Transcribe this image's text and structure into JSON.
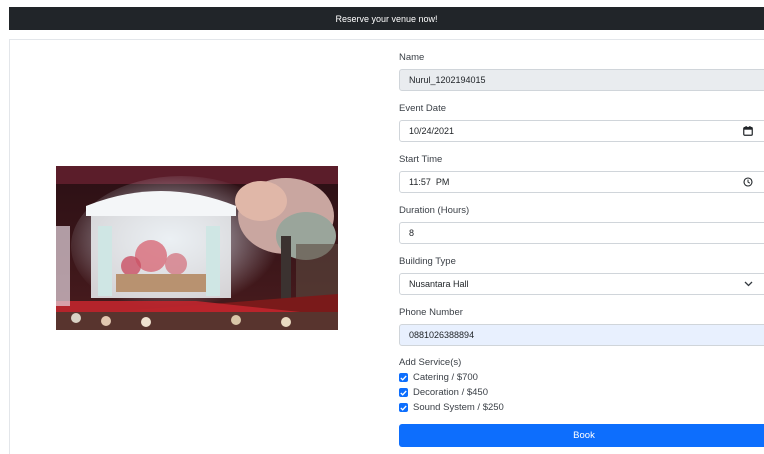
{
  "header": {
    "title": "Reserve your venue now!"
  },
  "form": {
    "name": {
      "label": "Name",
      "value": "Nurul_1202194015"
    },
    "event_date": {
      "label": "Event Date",
      "value": "10/24/2021",
      "icon": "calendar-icon"
    },
    "start_time": {
      "label": "Start Time",
      "value": "11:57  PM",
      "icon": "clock-icon"
    },
    "duration": {
      "label": "Duration (Hours)",
      "value": "8"
    },
    "building_type": {
      "label": "Building Type",
      "selected": "Nusantara Hall",
      "icon": "chevron-down-icon"
    },
    "phone": {
      "label": "Phone Number",
      "value": "0881026388894"
    },
    "services": {
      "label": "Add Service(s)",
      "items": [
        {
          "label": "Catering / $700",
          "checked": true
        },
        {
          "label": "Decoration / $450",
          "checked": true
        },
        {
          "label": "Sound System / $250",
          "checked": true
        }
      ]
    },
    "submit_label": "Book"
  },
  "colors": {
    "header_bg": "#212529",
    "accent": "#0d6efd",
    "readonly_bg": "#e9ecef",
    "autofill_bg": "#e8f0fe"
  }
}
